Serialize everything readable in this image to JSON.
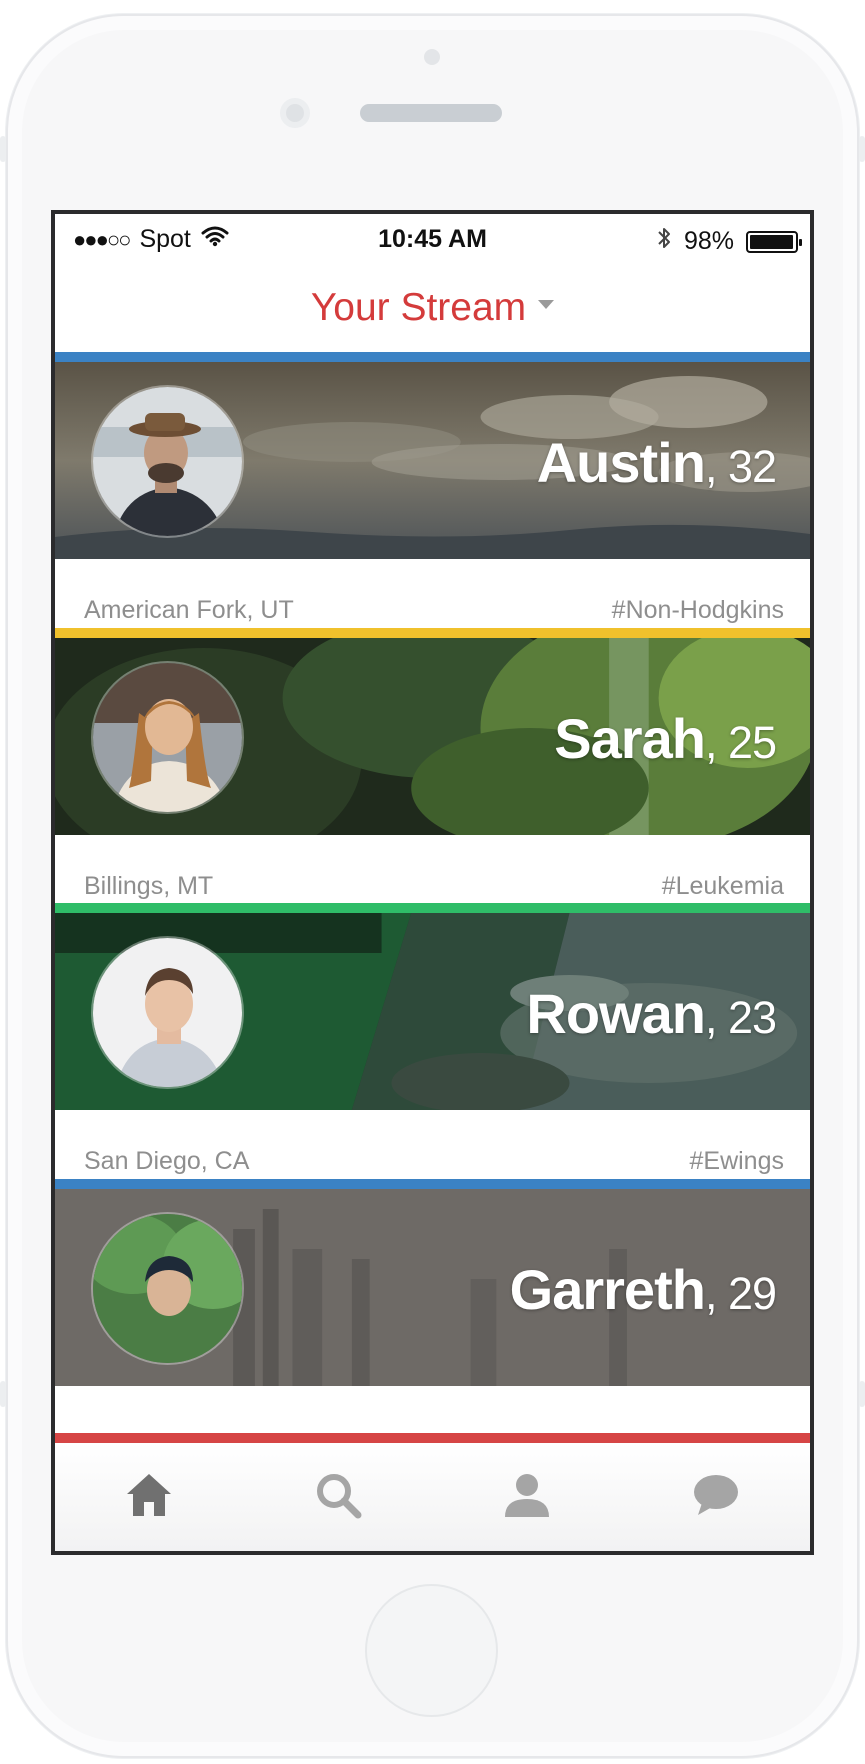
{
  "status_bar": {
    "signal": "●●●○○",
    "carrier": "Spot",
    "time": "10:45 AM",
    "battery_percent": "98%",
    "battery_level": 0.98
  },
  "header": {
    "title": "Your Stream"
  },
  "colors": {
    "accent": "#d43b3b",
    "blue": "#3b82c4",
    "yellow": "#f0c12c",
    "green": "#2fbd68",
    "red": "#d64545"
  },
  "stream": [
    {
      "name": "Austin",
      "age": ", 32",
      "location": "American Fork, UT",
      "tag": "#Non-Hodgkins",
      "stripe_color": "#3b82c4"
    },
    {
      "name": "Sarah",
      "age": ", 25",
      "location": "Billings, MT",
      "tag": "#Leukemia",
      "stripe_color": "#f0c12c"
    },
    {
      "name": "Rowan",
      "age": ", 23",
      "location": "San Diego, CA",
      "tag": "#Ewings",
      "stripe_color": "#2fbd68"
    },
    {
      "name": "Garreth",
      "age": ", 29",
      "location": "",
      "tag": "",
      "stripe_color": "#3b82c4"
    }
  ],
  "tab_bar": {
    "items": [
      {
        "icon": "home-icon"
      },
      {
        "icon": "search-icon"
      },
      {
        "icon": "profile-icon"
      },
      {
        "icon": "chat-icon"
      }
    ]
  }
}
